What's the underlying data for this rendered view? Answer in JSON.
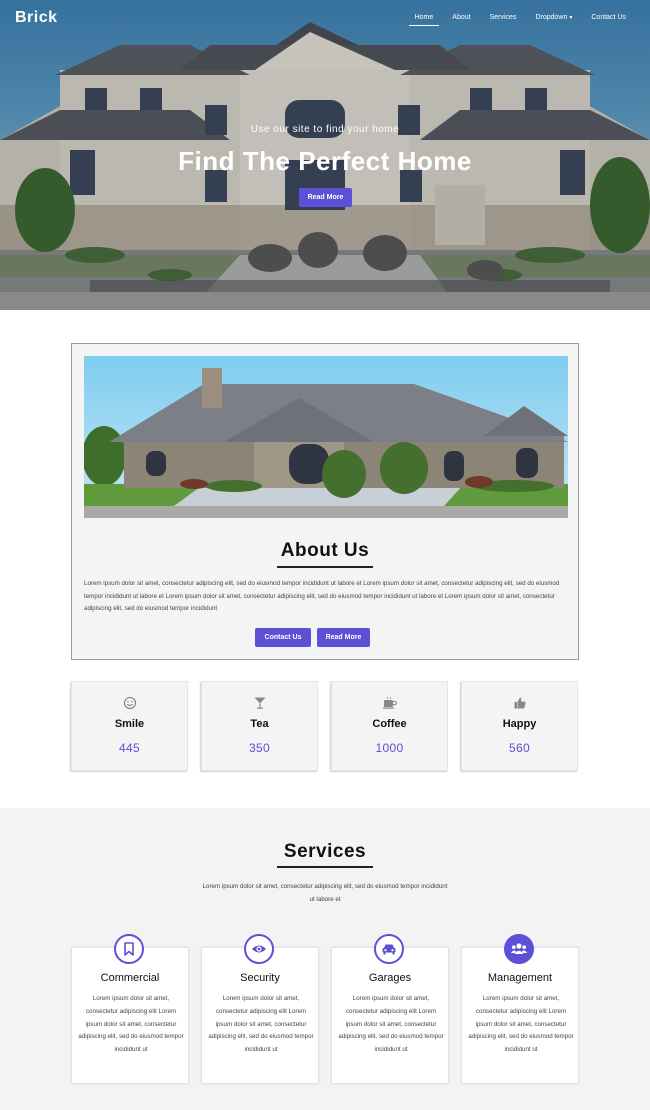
{
  "nav": {
    "brand": "Brick",
    "links": [
      {
        "label": "Home",
        "active": true
      },
      {
        "label": "About"
      },
      {
        "label": "Services"
      },
      {
        "label": "Dropdown",
        "has_caret": true
      },
      {
        "label": "Contact Us"
      }
    ]
  },
  "hero": {
    "subtitle": "Use our site to find your home",
    "title": "Find The Perfect Home",
    "button": "Read More"
  },
  "about": {
    "title": "About Us",
    "text": "Lorem ipsum dolor sit amet, consectetur adipiscing elit, sed do eiusmod tempor incididunt ut labore et Lorem ipsum dolor sit amet, consectetur adipiscing elit, sed do eiusmod tempor incididunt ut labore et Lorem ipsum dolor sit amet, consectetur adipiscing elit, sed do eiusmod tempor incididunt ut labore et Lorem ipsum dolor sit amet, consectetur adipiscing elit, sed do eiusmod tempor incididunt",
    "contact_button": "Contact Us",
    "read_button": "Read More"
  },
  "stats": [
    {
      "icon": "smile-icon",
      "label": "Smile",
      "value": "445"
    },
    {
      "icon": "cocktail-glass-icon",
      "label": "Tea",
      "value": "350"
    },
    {
      "icon": "coffee-cup-icon",
      "label": "Coffee",
      "value": "1000"
    },
    {
      "icon": "thumbs-up-icon",
      "label": "Happy",
      "value": "560"
    }
  ],
  "services": {
    "title": "Services",
    "description": "Lorem ipsum dolor sit amet, consectetur adipiscing elit, sed do eiusmod tempor incididunt ut labore et",
    "cards": [
      {
        "icon": "bookmark-icon",
        "title": "Commercial",
        "text": "Lorem ipsum dolor sit amet, consectetur adipiscing elit Lorem ipsum dolor sit amet, consectetur adipiscing elit, sed do eiusmod tempor incididunt ut"
      },
      {
        "icon": "eye-icon",
        "title": "Security",
        "text": "Lorem ipsum dolor sit amet, consectetur adipiscing elit Lorem ipsum dolor sit amet, consectetur adipiscing elit, sed do eiusmod tempor incididunt ut"
      },
      {
        "icon": "car-icon",
        "title": "Garages",
        "text": "Lorem ipsum dolor sit amet, consectetur adipiscing elit Lorem ipsum dolor sit amet, consectetur adipiscing elit, sed do eiusmod tempor incididunt ut"
      },
      {
        "icon": "users-icon",
        "title": "Management",
        "text": "Lorem ipsum dolor sit amet, consectetur adipiscing elit Lorem ipsum dolor sit amet, consectetur adipiscing elit, sed do eiusmod tempor incididunt ut"
      }
    ]
  },
  "colors": {
    "accent": "#5b50d6",
    "panel": "#f4f4f4"
  }
}
